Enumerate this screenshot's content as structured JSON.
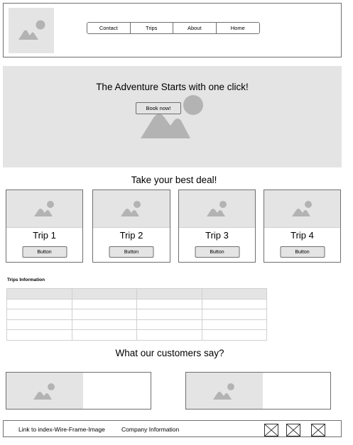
{
  "nav": {
    "items": [
      {
        "label": "Contact"
      },
      {
        "label": "Trips"
      },
      {
        "label": "About"
      },
      {
        "label": "Home"
      }
    ]
  },
  "hero": {
    "title": "The Adventure Starts with one click!",
    "button_label": "Book now!"
  },
  "deals": {
    "title": "Take your best deal!",
    "trips": [
      {
        "name": "Trip 1",
        "button_label": "Button"
      },
      {
        "name": "Trip 2",
        "button_label": "Button"
      },
      {
        "name": "Trip 3",
        "button_label": "Button"
      },
      {
        "name": "Trip 4",
        "button_label": "Button"
      }
    ]
  },
  "trips_info": {
    "title": "Trips Information"
  },
  "testimonials": {
    "title": "What our customers say?"
  },
  "footer": {
    "link_label": "Link to index-Wire-Frame-Image",
    "company_label": "Company Information"
  },
  "colors": {
    "placeholder_fill": "#e4e4e4",
    "placeholder_icon": "#b3b3b3",
    "border": "#6f6f6f"
  }
}
